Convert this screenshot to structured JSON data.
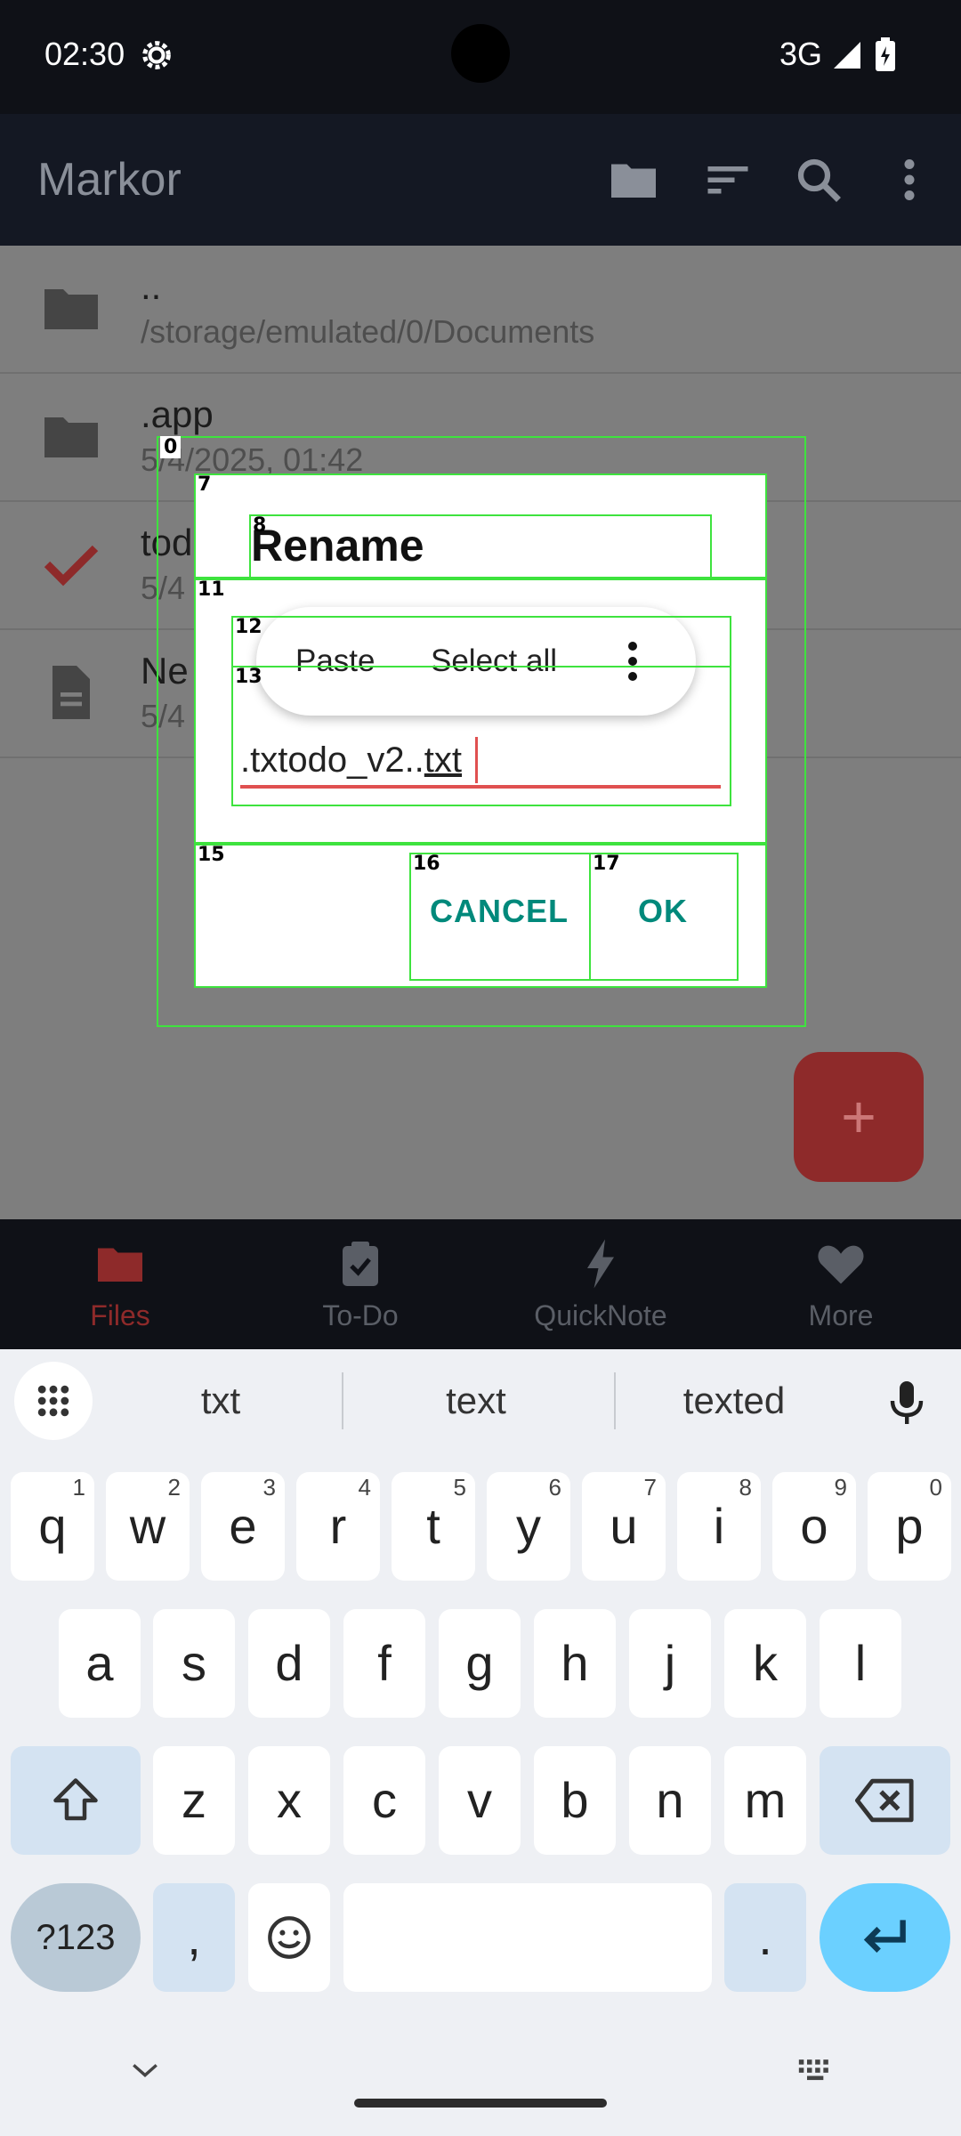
{
  "status_bar": {
    "time": "02:30",
    "network": "3G"
  },
  "app_bar": {
    "title": "Markor"
  },
  "file_list": [
    {
      "name": "..",
      "sub": "/storage/emulated/0/Documents",
      "icon": "folder-icon"
    },
    {
      "name": ".app",
      "sub": "5/4/2025, 01:42",
      "icon": "folder-icon"
    },
    {
      "name": "tod",
      "sub": "5/4",
      "icon": "check-icon"
    },
    {
      "name": "Ne",
      "sub": "5/4",
      "icon": "file-icon"
    }
  ],
  "fab": {
    "label": "+"
  },
  "bottom_nav": [
    {
      "label": "Files",
      "icon": "folder-icon",
      "active": true
    },
    {
      "label": "To-Do",
      "icon": "clipboard-check-icon",
      "active": false
    },
    {
      "label": "QuickNote",
      "icon": "bolt-icon",
      "active": false
    },
    {
      "label": "More",
      "icon": "heart-icon",
      "active": false
    }
  ],
  "dialog": {
    "title": "Rename",
    "field_value_prefix": ".txtodo_v2..",
    "field_value_selected": "txt",
    "cancel_label": "CANCEL",
    "ok_label": "OK"
  },
  "context_menu": {
    "paste_label": "Paste",
    "select_all_label": "Select all"
  },
  "annotations": [
    "0",
    "7",
    "8",
    "11",
    "12",
    "13",
    "15",
    "16",
    "17"
  ],
  "keyboard": {
    "suggestions": [
      "txt",
      "text",
      "texted"
    ],
    "row1": [
      {
        "key": "q",
        "hint": "1"
      },
      {
        "key": "w",
        "hint": "2"
      },
      {
        "key": "e",
        "hint": "3"
      },
      {
        "key": "r",
        "hint": "4"
      },
      {
        "key": "t",
        "hint": "5"
      },
      {
        "key": "y",
        "hint": "6"
      },
      {
        "key": "u",
        "hint": "7"
      },
      {
        "key": "i",
        "hint": "8"
      },
      {
        "key": "o",
        "hint": "9"
      },
      {
        "key": "p",
        "hint": "0"
      }
    ],
    "row2": [
      "a",
      "s",
      "d",
      "f",
      "g",
      "h",
      "j",
      "k",
      "l"
    ],
    "row3": [
      "z",
      "x",
      "c",
      "v",
      "b",
      "n",
      "m"
    ],
    "symbols_label": "?123",
    "comma_label": ",",
    "period_label": "."
  },
  "colors": {
    "accent_red": "#e05050",
    "dialog_button": "#00897b",
    "annotation": "#3ee33e"
  }
}
